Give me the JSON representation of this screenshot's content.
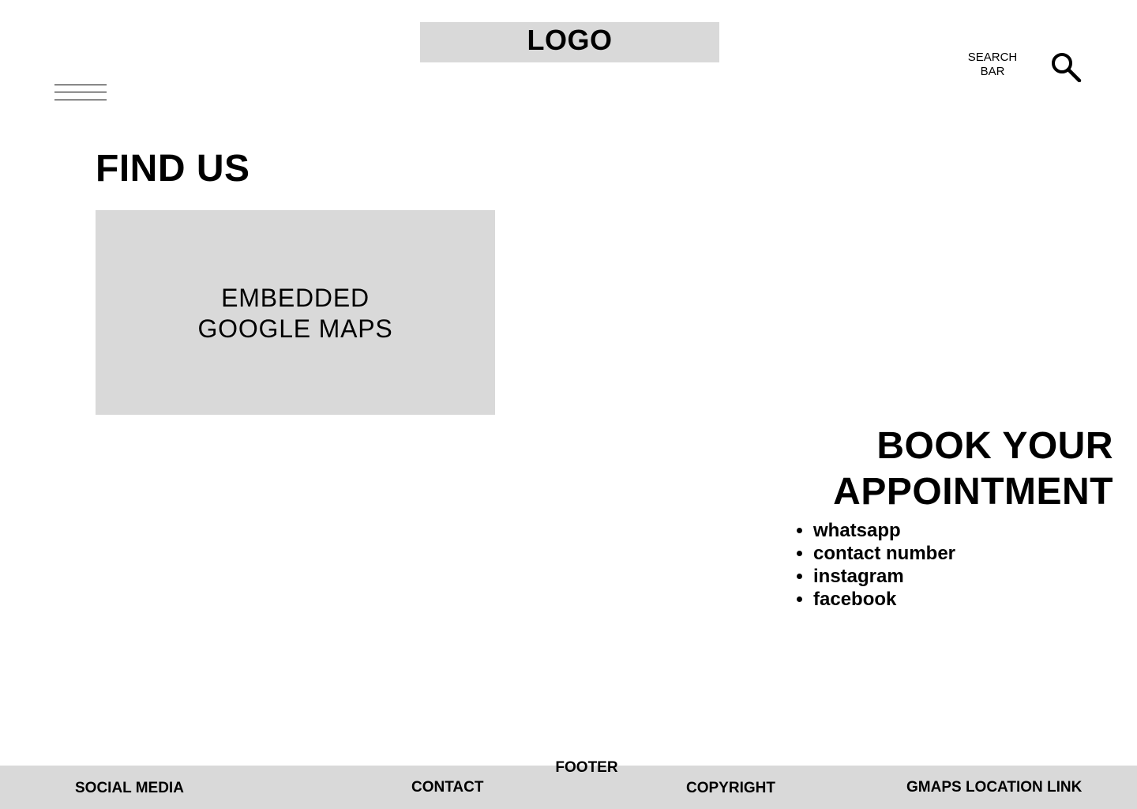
{
  "header": {
    "logo": "LOGO",
    "menu_icon": "hamburger-menu-icon",
    "search_label": "SEARCH BAR",
    "search_icon": "search-icon"
  },
  "find_us": {
    "title": "FIND US",
    "map_label": "EMBEDDED GOOGLE MAPS"
  },
  "booking": {
    "title": "BOOK YOUR APPOINTMENT",
    "items": [
      "whatsapp",
      "contact number",
      "instagram",
      "facebook"
    ]
  },
  "footer": {
    "label": "FOOTER",
    "social_media": "SOCIAL MEDIA",
    "contact": "CONTACT",
    "copyright": "COPYRIGHT",
    "gmaps_link": "GMAPS LOCATION LINK"
  },
  "colors": {
    "placeholder_gray": "#d9d9d9",
    "text": "#000000",
    "background": "#ffffff"
  }
}
